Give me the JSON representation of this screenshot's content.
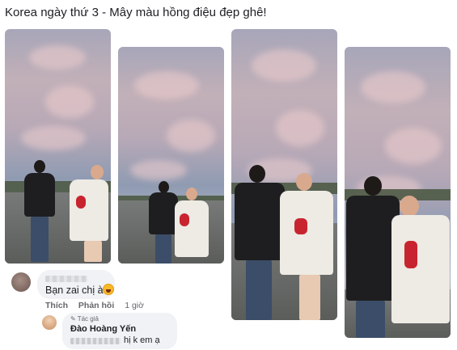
{
  "post": {
    "title": "Korea ngày thứ 3 - Mây màu hồng điệu đẹp ghê!"
  },
  "photos": [
    {
      "alt": "photo-1"
    },
    {
      "alt": "photo-2"
    },
    {
      "alt": "photo-3"
    },
    {
      "alt": "photo-4"
    }
  ],
  "comment": {
    "text": "Bạn zai chị à",
    "emoji_icon": "laughing-emoji-icon",
    "actions": {
      "like_label": "Thích",
      "reply_label": "Phản hồi",
      "time": "1 giờ"
    }
  },
  "reply": {
    "author_badge": "Tác giả",
    "author_badge_icon": "pen-icon",
    "author_name": "Đào Hoàng Yến",
    "text": "hị k em ạ"
  },
  "colors": {
    "bubble": "#f0f2f5",
    "text": "#1c1e21",
    "muted": "#65676b"
  }
}
